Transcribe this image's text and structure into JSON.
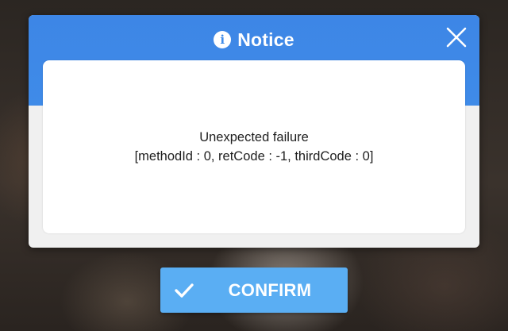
{
  "dialog": {
    "title": "Notice",
    "title_icon": "info-icon",
    "info_glyph": "i",
    "close_icon": "close-icon",
    "message_lines": [
      "Unexpected failure",
      "[methodId : 0, retCode : -1, thirdCode : 0]"
    ]
  },
  "confirm": {
    "label": "CONFIRM",
    "icon": "checkmark-icon"
  },
  "colors": {
    "header_blue": "#3f8be8",
    "button_blue": "#5aaef3",
    "dialog_bg": "#f0f0f0",
    "card_bg": "#ffffff",
    "text": "#1e1e1e"
  }
}
